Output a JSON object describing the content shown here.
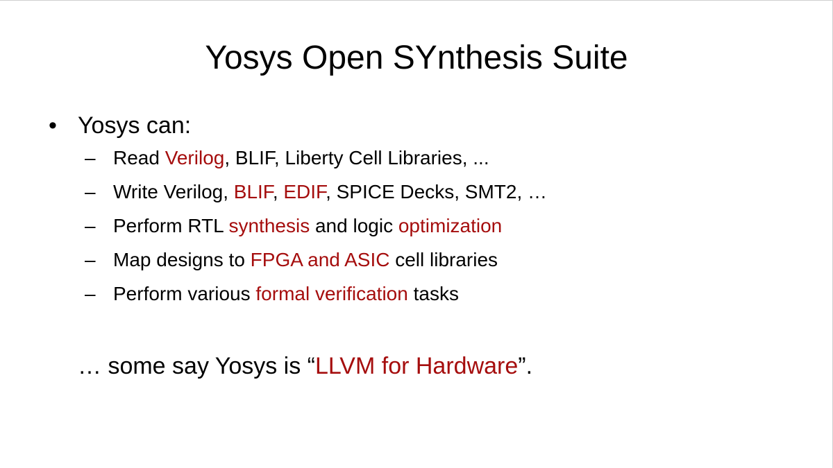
{
  "slide": {
    "title": "Yosys Open SYnthesis Suite",
    "bullet": {
      "marker": "•",
      "text": "Yosys can:"
    },
    "sub_marker": "–",
    "items": [
      {
        "parts": [
          {
            "text": "Read ",
            "highlight": false
          },
          {
            "text": "Verilog",
            "highlight": true
          },
          {
            "text": ", BLIF, Liberty Cell Libraries, ...",
            "highlight": false
          }
        ]
      },
      {
        "parts": [
          {
            "text": "Write Verilog, ",
            "highlight": false
          },
          {
            "text": "BLIF",
            "highlight": true
          },
          {
            "text": ", ",
            "highlight": false
          },
          {
            "text": "EDIF",
            "highlight": true
          },
          {
            "text": ", SPICE Decks, SMT2, …",
            "highlight": false
          }
        ]
      },
      {
        "parts": [
          {
            "text": "Perform RTL ",
            "highlight": false
          },
          {
            "text": "synthesis",
            "highlight": true
          },
          {
            "text": " and logic ",
            "highlight": false
          },
          {
            "text": "optimization",
            "highlight": true
          }
        ]
      },
      {
        "parts": [
          {
            "text": "Map designs to ",
            "highlight": false
          },
          {
            "text": "FPGA and ASIC",
            "highlight": true
          },
          {
            "text": " cell libraries",
            "highlight": false
          }
        ]
      },
      {
        "parts": [
          {
            "text": "Perform various ",
            "highlight": false
          },
          {
            "text": "formal verification",
            "highlight": true
          },
          {
            "text": " tasks",
            "highlight": false
          }
        ]
      }
    ],
    "closing": {
      "parts": [
        {
          "text": "… some say Yosys is “",
          "highlight": false
        },
        {
          "text": "LLVM for Hardware",
          "highlight": true
        },
        {
          "text": "”.",
          "highlight": false
        }
      ]
    }
  },
  "colors": {
    "text": "#000000",
    "highlight": "#a50d0d",
    "background": "#ffffff"
  }
}
